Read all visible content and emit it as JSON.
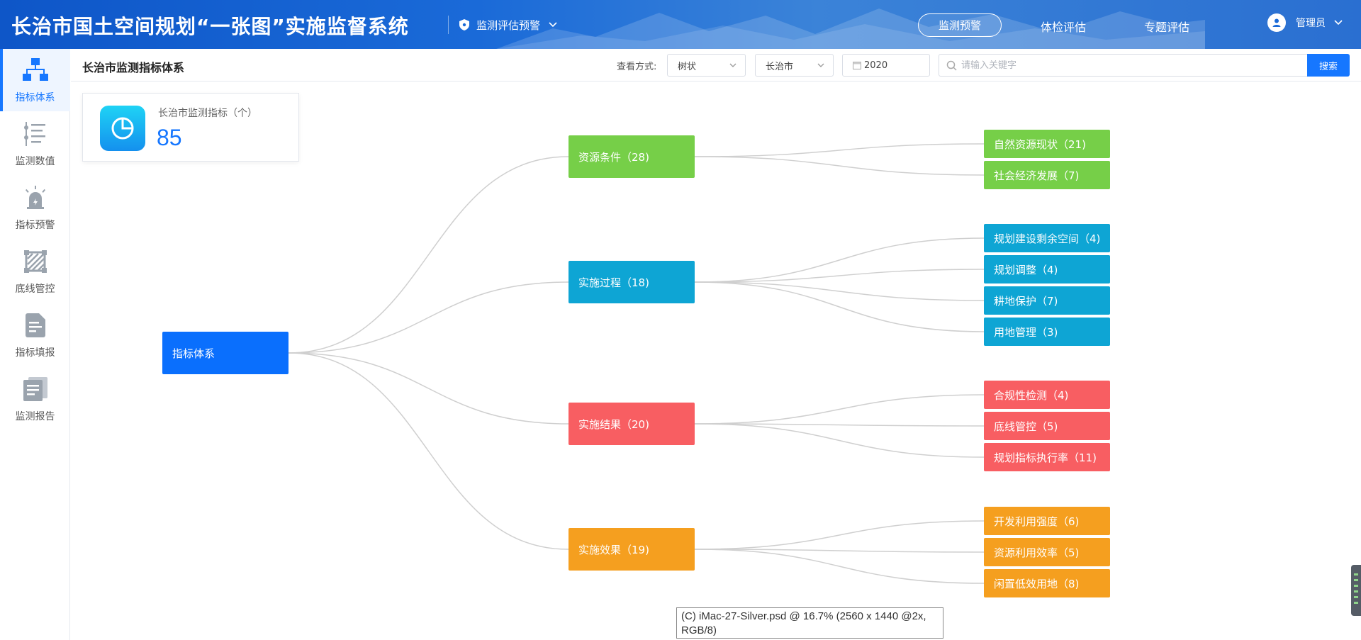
{
  "header": {
    "app_title": "长治市国土空间规划“一张图”实施监督系统",
    "module_label": "监测评估预警",
    "nav": [
      {
        "label": "监测预警",
        "active": true
      },
      {
        "label": "体检评估",
        "active": false
      },
      {
        "label": "专题评估",
        "active": false
      }
    ],
    "user_label": "管理员"
  },
  "sidebar": {
    "items": [
      {
        "label": "指标体系",
        "icon": "hierarchy-icon",
        "active": true
      },
      {
        "label": "监测数值",
        "icon": "list-settings-icon",
        "active": false
      },
      {
        "label": "指标预警",
        "icon": "alarm-icon",
        "active": false
      },
      {
        "label": "底线管控",
        "icon": "boundary-icon",
        "active": false
      },
      {
        "label": "指标填报",
        "icon": "form-icon",
        "active": false
      },
      {
        "label": "监测报告",
        "icon": "report-icon",
        "active": false
      }
    ]
  },
  "toolbar": {
    "page_title": "长治市监测指标体系",
    "view_label": "查看方式:",
    "view_mode": "树状",
    "region": "长治市",
    "year": "2020",
    "search_placeholder": "请输入关键字",
    "search_button": "搜索"
  },
  "stat": {
    "label": "长治市监测指标（个）",
    "value": "85"
  },
  "tree": {
    "root": {
      "label": "指标体系",
      "color": "#0a6ffd"
    },
    "groups": [
      {
        "label": "资源条件（28)",
        "color": "#76cf48",
        "children": [
          "自然资源现状（21)",
          "社会经济发展（7)"
        ]
      },
      {
        "label": "实施过程（18)",
        "color": "#0ea5d4",
        "children": [
          "规划建设剩余空间（4)",
          "规划调整（4)",
          "耕地保护（7)",
          "用地管理（3)"
        ]
      },
      {
        "label": "实施结果（20)",
        "color": "#f85e62",
        "children": [
          "合规性检测（4)",
          "底线管控（5)",
          "规划指标执行率（11)"
        ]
      },
      {
        "label": "实施效果（19)",
        "color": "#f59f1f",
        "children": [
          "开发利用强度（6)",
          "资源利用效率（5)",
          "闲置低效用地（8)"
        ]
      }
    ]
  },
  "footer_note": {
    "line1": "(C) iMac-27-Silver.psd @ 16.7% (2560 x 1440 @2x,",
    "line2": "RGB/8)"
  }
}
